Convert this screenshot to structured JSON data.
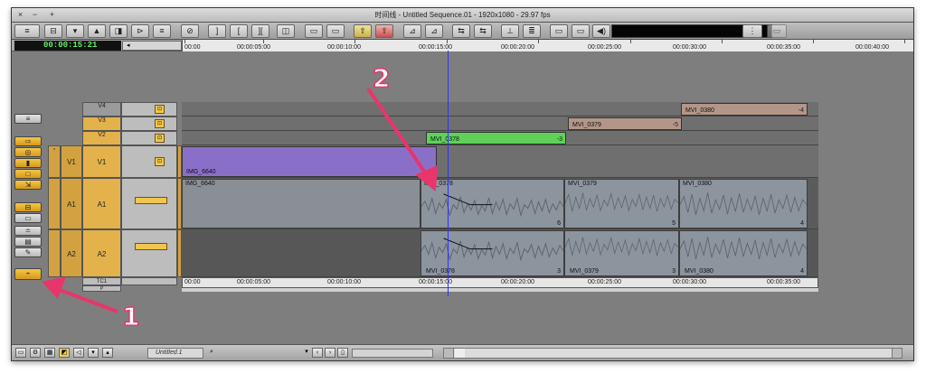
{
  "window": {
    "title": "时间线 - Untitled Sequence.01 - 1920x1080 - 29.97 fps",
    "buttons": [
      "×",
      "−",
      "+"
    ]
  },
  "toolbar": {
    "buttons": [
      "≡",
      "⊟",
      "▾",
      "▲",
      "◨",
      "⊳",
      "≡",
      "⊘",
      "]",
      "[",
      "][",
      "◫",
      "▭",
      "▭",
      "⇧",
      "⇧",
      "⊿",
      "⊿",
      "⇆",
      "⇆",
      "⊥",
      "≣",
      "▭",
      "▭",
      "◀)"
    ],
    "meter_label": ""
  },
  "timecode": {
    "current": "00:00:15:21",
    "nav_label": "◂"
  },
  "ruler": {
    "ticks": [
      "00:00",
      "00:00:05:00",
      "00:00:10:00",
      "00:00:15:00",
      "00:00:20:00",
      "00:00:25:00",
      "00:00:30:00",
      "00:00:35:00",
      "00:00:40:00"
    ]
  },
  "tracks": {
    "video": [
      {
        "name": "V4"
      },
      {
        "name": "V3"
      },
      {
        "name": "V2"
      },
      {
        "name": "V1",
        "src": "V1"
      }
    ],
    "audio": [
      {
        "name": "A1",
        "src": "A1"
      },
      {
        "name": "A2",
        "src": "A2"
      }
    ],
    "tc": "TC1",
    "p": "P"
  },
  "clips": {
    "v4": {
      "name": "MVI_0380",
      "trans": "-4",
      "color": "#b39688"
    },
    "v3": {
      "name": "MVI_0379",
      "trans": "-5",
      "color": "#b39688"
    },
    "v2": {
      "name": "MVI_0378",
      "trans": "-3",
      "color": "#5fd159"
    },
    "v1": {
      "name": "IMG_6640",
      "color": "#8a6fc9"
    },
    "a1": [
      {
        "name": "IMG_6640",
        "trans": ""
      },
      {
        "name": "MVI_0378",
        "trans": "6"
      },
      {
        "name": "MVI_0379",
        "trans": "5"
      },
      {
        "name": "MVI_0380",
        "trans": "4"
      }
    ],
    "a2": [
      {
        "name": "MVI_0378",
        "trans": "3"
      },
      {
        "name": "MVI_0379",
        "trans": "3"
      },
      {
        "name": "MVI_0380",
        "trans": "4"
      }
    ]
  },
  "bottom_ruler": {
    "ticks": [
      "00:00",
      "00:00:05:00",
      "00:00:10:00",
      "00:00:15:00",
      "00:00:20:00",
      "00:00:25:00",
      "00:00:30:00",
      "00:00:35:00"
    ]
  },
  "statusbar": {
    "sequence_name": "Untitled.1"
  },
  "annotations": {
    "one": "1",
    "two": "2"
  },
  "colors": {
    "accent": "#e8356b",
    "timecode_green": "#5ff05f",
    "playhead": "#3030ff"
  }
}
